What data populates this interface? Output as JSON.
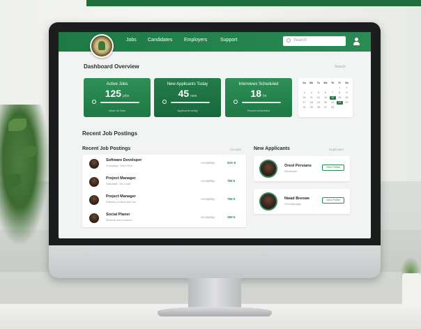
{
  "header": {
    "nav": [
      "Jobs",
      "Candidates",
      "Employers",
      "Support"
    ],
    "search_placeholder": "Search"
  },
  "dashboard": {
    "title": "Dashboard Overview",
    "right_label": "Search"
  },
  "stats": [
    {
      "label": "Active Jobs",
      "value": "125",
      "unit": "jobs",
      "footer": "Issue all Jobs"
    },
    {
      "label": "New Applicants Today",
      "value": "45",
      "unit": "new",
      "footer": "Applicants today"
    },
    {
      "label": "Interviews Scheduled",
      "value": "18",
      "unit": "Int",
      "footer": "Recent scheduled"
    }
  ],
  "calendar": {
    "headers": [
      "Su",
      "Mo",
      "Tu",
      "We",
      "Th",
      "Fr",
      "Sa"
    ],
    "days": [
      "",
      "",
      "",
      "",
      "",
      "1",
      "2",
      "3",
      "4",
      "5",
      "6",
      "7",
      "8",
      "9",
      "10",
      "11",
      "12",
      "13",
      "14",
      "15",
      "16",
      "17",
      "18",
      "19",
      "20",
      "21",
      "22",
      "23",
      "24",
      "25",
      "26",
      "27",
      "28"
    ],
    "highlighted": [
      "14",
      "22"
    ]
  },
  "recent_section_title": "Recent Job Postings",
  "jobs_panel": {
    "title": "Recent Job Postings",
    "right_label": "Accepts",
    "rows": [
      {
        "title": "Software Developer",
        "detail": "Company / Tech Firm",
        "status": "Accepting",
        "amount": "$1K-5"
      },
      {
        "title": "Project Manager",
        "detail": "Standard / Inc Lead",
        "status": "Accepting",
        "amount": "TBI-5"
      },
      {
        "title": "Project Manager",
        "detail": "Delivery on time and ntu",
        "status": "Accepting",
        "amount": "TBI-5"
      },
      {
        "title": "Social Planer",
        "detail": "Remote ads Uchurch",
        "status": "Accepting",
        "amount": "SBI-5"
      }
    ]
  },
  "applicants_panel": {
    "title": "New Applicants",
    "right_label": "Duplicates",
    "items": [
      {
        "name": "Oreol Persians",
        "role": "Developer",
        "button": "View Profile"
      },
      {
        "name": "Nwad Breowe",
        "role": "Civil Manager",
        "button": "View Profile"
      }
    ]
  }
}
